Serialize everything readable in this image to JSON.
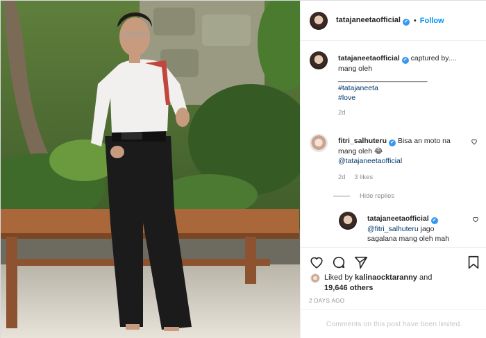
{
  "post": {
    "username": "tatajaneetaofficial",
    "follow_label": "Follow",
    "verified_glyph": "✔"
  },
  "caption": {
    "username": "tatajaneetaofficial",
    "text_1": "captured by....",
    "text_2": "mang oleh",
    "divider": "______________________",
    "hashtag_1": "#tatajaneeta",
    "hashtag_2": "#love",
    "time": "2d"
  },
  "comment": {
    "username": "fitri_salhuteru",
    "text_1": "Bisa an moto na",
    "text_2": "mang oleh 😂",
    "mention": "@tatajaneetaofficial",
    "time": "2d",
    "likes": "3 likes",
    "hide_replies": "Hide replies"
  },
  "reply": {
    "username": "tatajaneetaofficial",
    "mention": "@fitri_salhuteru",
    "text_1": " jago",
    "text_2": "sagalana mang oleh mah"
  },
  "likes": {
    "prefix": "Liked by",
    "user": "kalinaocktaranny",
    "and": "and",
    "others": "19,646 others"
  },
  "date": "2 DAYS AGO",
  "comments_limited": "Comments on this post have been limited.",
  "icons": [
    "heart-icon",
    "comment-icon",
    "share-icon",
    "bookmark-icon",
    "verified-icon"
  ],
  "colors": {
    "accent": "#0095f6",
    "muted": "#8e8e8e",
    "border": "#dbdbdb"
  }
}
